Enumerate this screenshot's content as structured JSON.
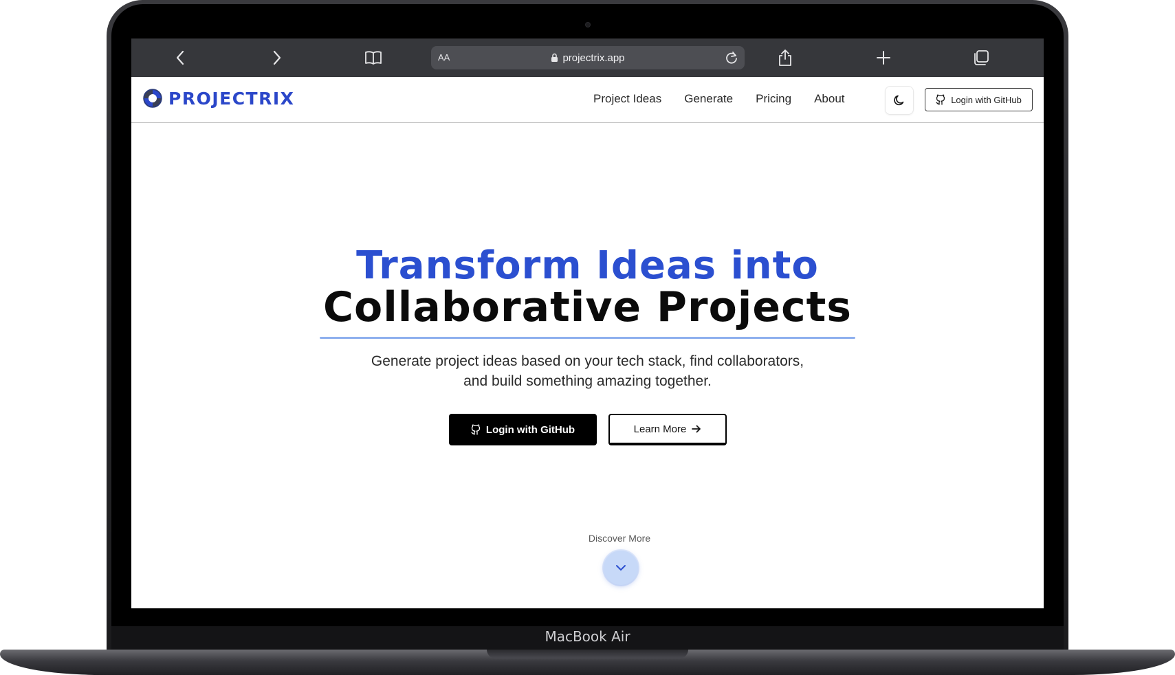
{
  "browser": {
    "text_size_label": "AA",
    "url": "projectrix.app"
  },
  "site": {
    "brand": "PROJECTRIX",
    "nav_links": [
      "Project Ideas",
      "Generate",
      "Pricing",
      "About"
    ],
    "nav_login_label": "Login with GitHub"
  },
  "hero": {
    "title_line1": "Transform Ideas into",
    "title_line2": "Collaborative Projects",
    "subtitle_line1": "Generate project ideas based on your tech stack, find collaborators,",
    "subtitle_line2": "and build something amazing together.",
    "primary_cta": "Login with GitHub",
    "secondary_cta": "Learn More",
    "discover_label": "Discover More"
  },
  "device": {
    "label": "MacBook Air"
  },
  "colors": {
    "brand_blue": "#2b4fd0",
    "accent_underline": "#8eb0ee",
    "discover_button": "#c7d9f8"
  },
  "icons": {
    "back": "chevron-left-icon",
    "forward": "chevron-right-icon",
    "bookmarks": "book-icon",
    "lock": "lock-icon",
    "reload": "reload-icon",
    "share": "share-icon",
    "new_tab": "plus-icon",
    "tabs": "tabs-icon",
    "theme": "moon-icon",
    "github": "github-icon",
    "arrow": "arrow-right-icon",
    "discover": "chevron-down-icon"
  }
}
